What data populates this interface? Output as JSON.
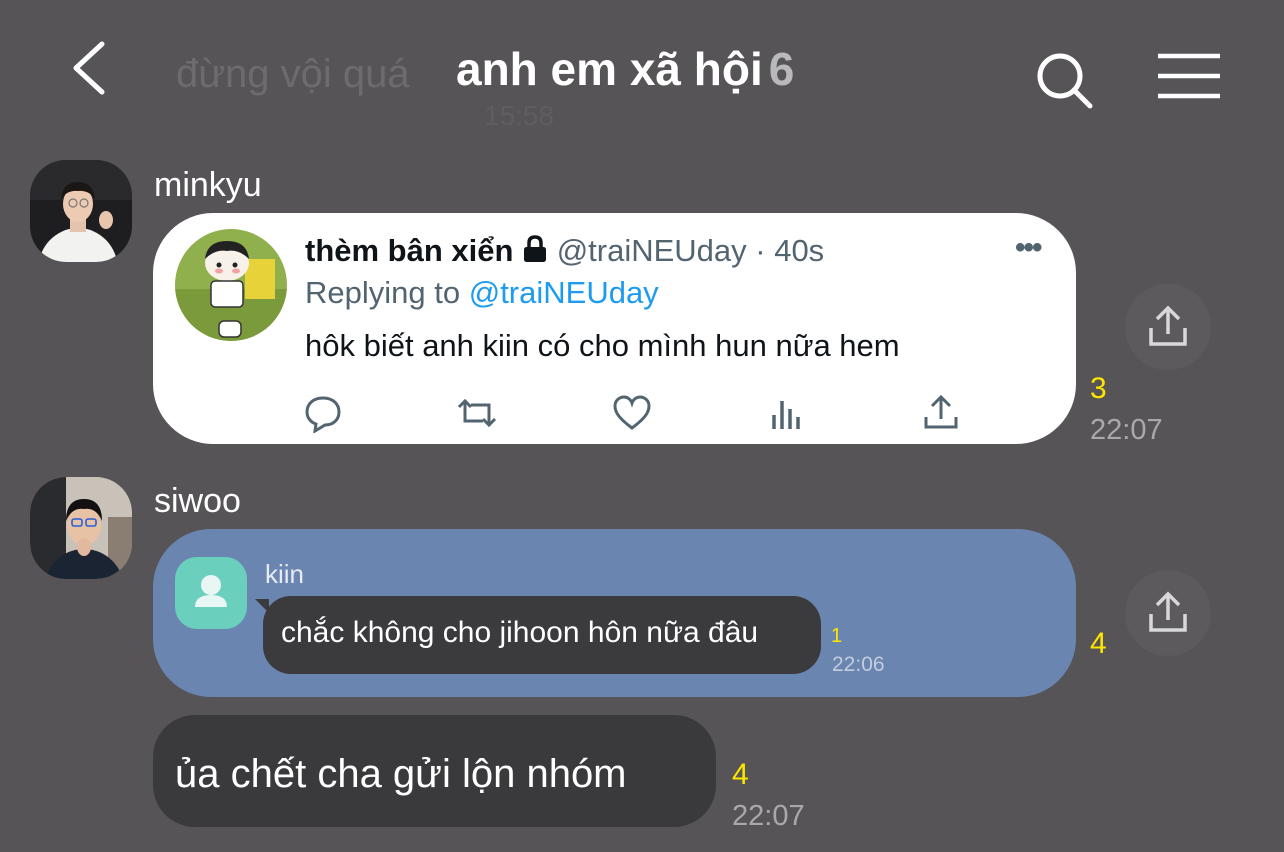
{
  "header": {
    "back_icon": "chevron-left-icon",
    "title": "anh em xã hội",
    "member_count": "6",
    "search_icon": "search-icon",
    "menu_icon": "hamburger-menu-icon",
    "ghost_message": "đừng vội quá",
    "ghost_time": "15:58"
  },
  "messages": [
    {
      "sender": "minkyu",
      "tweet": {
        "display_name": "thèm bân xiển",
        "lock_icon": "lock-icon",
        "handle_time": "@traiNEUday · 40s",
        "replying_prefix": "Replying to",
        "replying_to": "@traiNEUday",
        "text": "hôk biết anh kiin có cho mình hun nữa hem",
        "more": "•••",
        "actions": [
          "reply-icon",
          "retweet-icon",
          "like-icon",
          "views-icon",
          "share-icon"
        ]
      },
      "unread": "3",
      "time": "22:07"
    },
    {
      "sender": "siwoo",
      "forwarded": {
        "name": "kiin",
        "text": "chắc không cho jihoon hôn nữa đâu",
        "unread": "1",
        "time": "22:06"
      },
      "unread": "4"
    },
    {
      "text": "ủa chết cha gửi lộn nhóm",
      "unread": "4",
      "time": "22:07"
    }
  ],
  "colors": {
    "background": "#565457",
    "unread": "#ffe600",
    "forward_bubble": "#6a85b0",
    "twitter_blue": "#1d9bf0"
  }
}
